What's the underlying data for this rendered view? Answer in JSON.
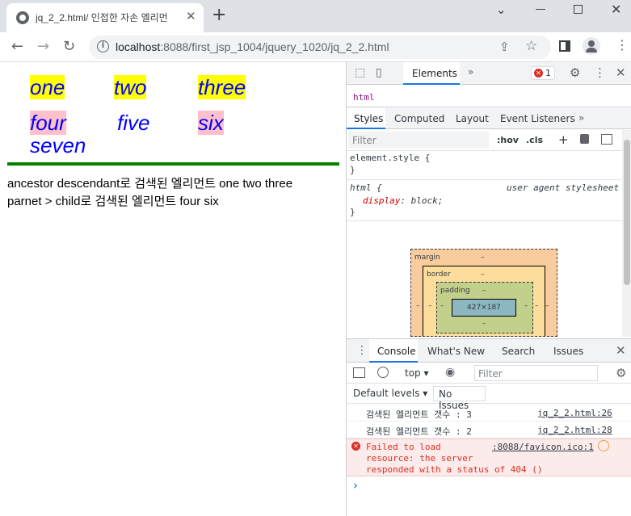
{
  "browser": {
    "tab_title": "jq_2_2.html/ 인접한 자손 엘리먼",
    "tab_close": "✕",
    "new_tab": "+",
    "url_host": "localhost",
    "url_rest": ":8088/first_jsp_1004/jquery_1020/jq_2_2.html"
  },
  "page": {
    "items": [
      "one",
      "two",
      "three",
      "four",
      "five",
      "six",
      "seven"
    ],
    "result1": "ancestor descendant로 검색된 엘리먼트 one two three",
    "result2": "parnet > child로 검색된 엘리먼트 four six"
  },
  "devtools": {
    "tabs": {
      "elements": "Elements",
      "more": "»"
    },
    "error_count": "1",
    "breadcrumb": "html",
    "style_tabs": [
      "Styles",
      "Computed",
      "Layout",
      "Event Listeners",
      "»"
    ],
    "filter_placeholder": "Filter",
    "hov": ":hov",
    "cls": ".cls",
    "rule1_selector": "element.style {",
    "rule1_close": "}",
    "rule2_selector": "html {",
    "rule2_source": "user agent stylesheet",
    "rule2_prop": "display",
    "rule2_value": "block;",
    "rule2_close": "}",
    "boxmodel": {
      "margin": "margin",
      "border": "border",
      "padding": "padding",
      "dash": "–",
      "content": "427×187"
    },
    "drawer_tabs": [
      "Console",
      "What's New",
      "Search",
      "Issues"
    ],
    "context": "top",
    "console_filter": "Filter",
    "default_levels": "Default levels",
    "no_issues": "No Issues",
    "logs": [
      {
        "text": "검색된 엘리먼트 갯수 : 3",
        "source": "jq_2_2.html:26"
      },
      {
        "text": "검색된 엘리먼트 갯수 : 2",
        "source": "jq_2_2.html:28"
      }
    ],
    "error": {
      "line1": "Failed to load",
      "line2": "resource: the server",
      "line3": "responded with a status of 404 ()",
      "source": ":8088/favicon.ico:1"
    },
    "prompt": "›"
  },
  "colors": {
    "accent": "#1a73e8",
    "green_rule": "#008000",
    "yellow": "#ffff00",
    "pink": "#ffc0cb",
    "error_bg": "#fcebeb",
    "error_text": "#d93025"
  }
}
